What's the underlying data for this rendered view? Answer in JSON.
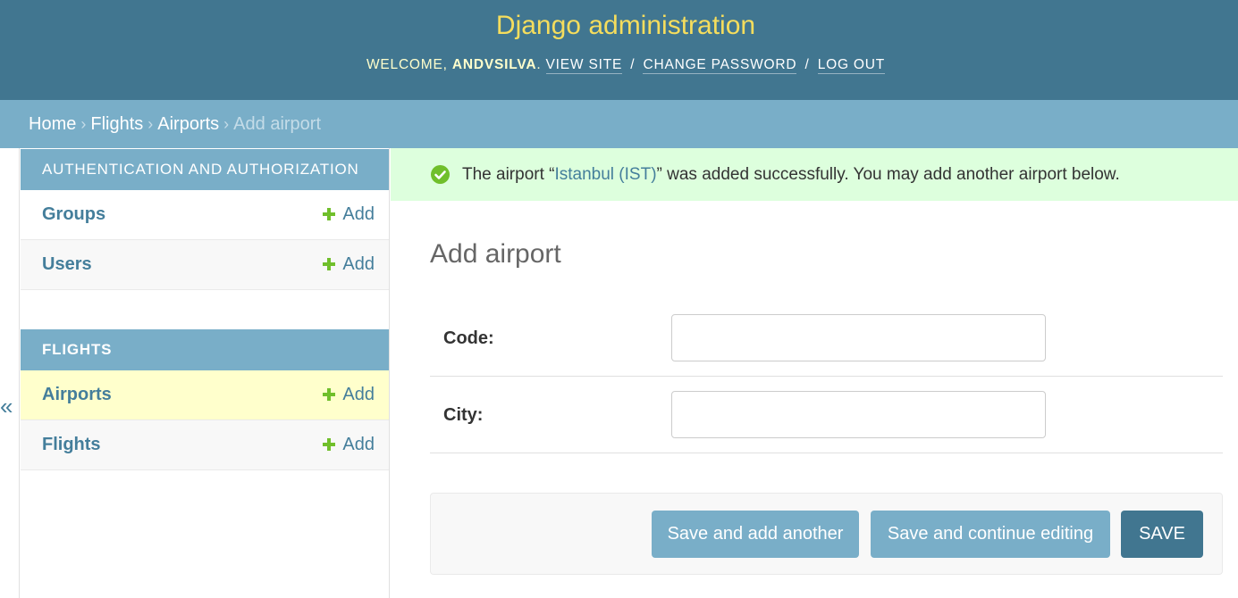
{
  "header": {
    "site_title": "Django administration",
    "welcome_prefix": "Welcome, ",
    "username": "andvsilva",
    "welcome_suffix": ".",
    "links": [
      "View site",
      "Change password",
      "Log out"
    ],
    "separator": "/"
  },
  "breadcrumbs": {
    "items": [
      "Home",
      "Flights",
      "Airports"
    ],
    "current": "Add airport",
    "separator": "›"
  },
  "sidebar": {
    "toggle_label": "«",
    "modules": [
      {
        "caption": "Authentication and Authorization",
        "models": [
          {
            "name": "Groups",
            "add_label": "Add"
          },
          {
            "name": "Users",
            "add_label": "Add"
          }
        ]
      },
      {
        "caption": "Flights",
        "models": [
          {
            "name": "Airports",
            "add_label": "Add",
            "current": true
          },
          {
            "name": "Flights",
            "add_label": "Add"
          }
        ]
      }
    ]
  },
  "message": {
    "prefix": "The airport “",
    "link_text": "Istanbul (IST)",
    "suffix": "” was added successfully. You may add another airport below.",
    "icon": "success-check-icon"
  },
  "form": {
    "title": "Add airport",
    "fields": [
      {
        "label": "Code:",
        "value": ""
      },
      {
        "label": "City:",
        "value": ""
      }
    ]
  },
  "submit": {
    "save_add_another": "Save and add another",
    "save_continue": "Save and continue editing",
    "save": "Save"
  },
  "colors": {
    "header_bg": "#417690",
    "title": "#f5dd5d",
    "breadcrumb_bg": "#79aec8",
    "link": "#447e9b",
    "success_bg": "#ddffdd",
    "add_icon": "#70bf2b",
    "current_row": "#ffffcc"
  }
}
